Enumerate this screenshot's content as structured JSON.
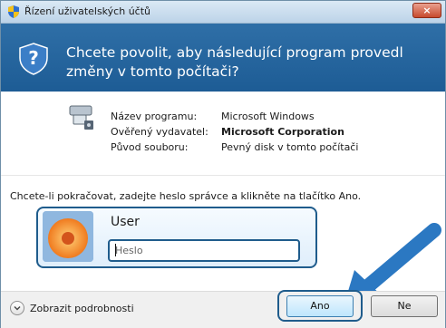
{
  "window": {
    "title": "Řízení uživatelských účtů",
    "close_label": "×"
  },
  "banner": {
    "question": "Chcete povolit, aby následující program provedl změny v tomto počítači?"
  },
  "program_info": {
    "rows": [
      {
        "label": "Název programu:",
        "value": "Microsoft Windows"
      },
      {
        "label": "Ověřený vydavatel:",
        "value": "Microsoft Corporation"
      },
      {
        "label": "Původ souboru:",
        "value": "Pevný disk v tomto počítači"
      }
    ]
  },
  "prompt_text": "Chcete-li pokračovat, zadejte heslo správce a klikněte na tlačítko Ano.",
  "credentials": {
    "user_name": "User",
    "password_placeholder": "Heslo",
    "password_value": ""
  },
  "footer": {
    "details_label": "Zobrazit podrobnosti",
    "yes_label": "Ano",
    "no_label": "Ne"
  },
  "colors": {
    "banner": "#1d5c95",
    "highlight": "#1f5c8c",
    "close": "#c74a2d"
  }
}
